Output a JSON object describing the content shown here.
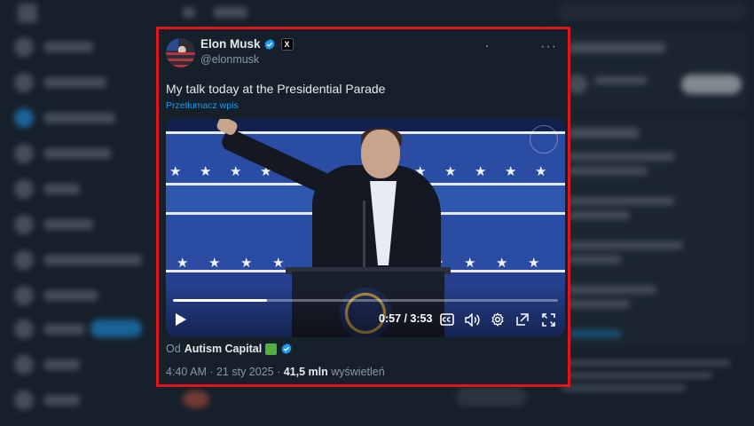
{
  "tweet": {
    "author_name": "Elon Musk",
    "handle": "@elonmusk",
    "text": "My talk today at the Presidential Parade",
    "translate_label": "Przetłumacz wpis",
    "more_label": "···",
    "x_badge": "X",
    "source_prefix": "Od",
    "source_name": "Autism Capital",
    "timestamp": "4:40 AM · 21 sty 2025 · ",
    "views_count": "41,5 mln",
    "views_label": "wyświetleń"
  },
  "video": {
    "current_time": "0:57",
    "duration": "3:53",
    "time_display": "0:57 / 3:53",
    "progress_fraction": 0.245
  },
  "colors": {
    "highlight_border": "#e1141c",
    "verified": "#1d9bf0",
    "link": "#1d9bf0",
    "background": "#15202b"
  },
  "icons": [
    "verified-badge-icon",
    "x-affiliate-icon",
    "more-icon",
    "play-icon",
    "captions-icon",
    "volume-icon",
    "settings-icon",
    "pip-icon",
    "fullscreen-icon",
    "puzzle-emoji-icon"
  ]
}
